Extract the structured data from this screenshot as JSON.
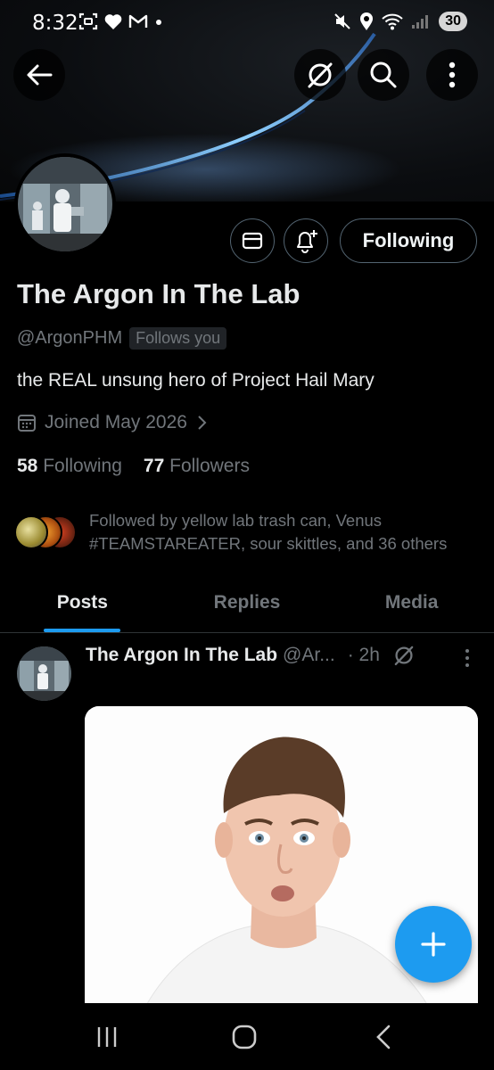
{
  "status_bar": {
    "time": "8:32",
    "battery": "30"
  },
  "profile": {
    "display_name": "The Argon In The Lab",
    "handle": "@ArgonPHM",
    "follows_you_badge": "Follows you",
    "bio": "the REAL unsung hero of Project Hail Mary",
    "joined": "Joined May 2026",
    "following_count": "58",
    "following_label": "Following",
    "followers_count": "77",
    "followers_label": "Followers",
    "followed_by_text": "Followed by yellow lab trash can, Venus #TEAMSTAREATER, sour skittles, and 36 others",
    "follow_button_label": "Following"
  },
  "tabs": [
    {
      "label": "Posts",
      "active": true
    },
    {
      "label": "Replies",
      "active": false
    },
    {
      "label": "Media",
      "active": false
    }
  ],
  "post": {
    "author": "The Argon In The Lab",
    "handle": "@Ar...",
    "time": "· 2h"
  },
  "colors": {
    "accent": "#1d9bf0",
    "muted": "#71767b",
    "border": "#536471"
  },
  "icons": {
    "back": "arrow-left-icon",
    "grok": "grok-icon",
    "search": "search-icon",
    "more": "more-vertical-icon",
    "message": "mail-icon",
    "notify": "bell-plus-icon",
    "calendar": "calendar-icon",
    "fab": "plus-icon"
  }
}
